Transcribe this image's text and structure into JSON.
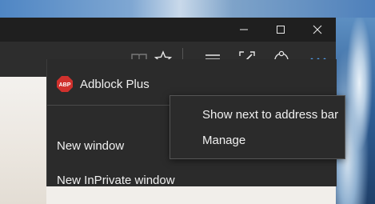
{
  "titlebar": {
    "minimize_icon": "minimize-icon",
    "maximize_icon": "maximize-icon",
    "close_icon": "close-icon"
  },
  "toolbar": {
    "icons": [
      "reading-view-icon",
      "favorite-star-icon",
      "hub-icon",
      "web-note-icon",
      "share-icon",
      "more-icon"
    ]
  },
  "menu": {
    "extension_label": "Adblock Plus",
    "extension_badge": "ABP",
    "items": [
      "New window",
      "New InPrivate window"
    ]
  },
  "submenu": {
    "items": [
      "Show next to address bar",
      "Manage"
    ]
  },
  "colors": {
    "accent": "#2b7fd6",
    "menu_bg": "#2b2b2b",
    "abp_red": "#d0312d"
  }
}
